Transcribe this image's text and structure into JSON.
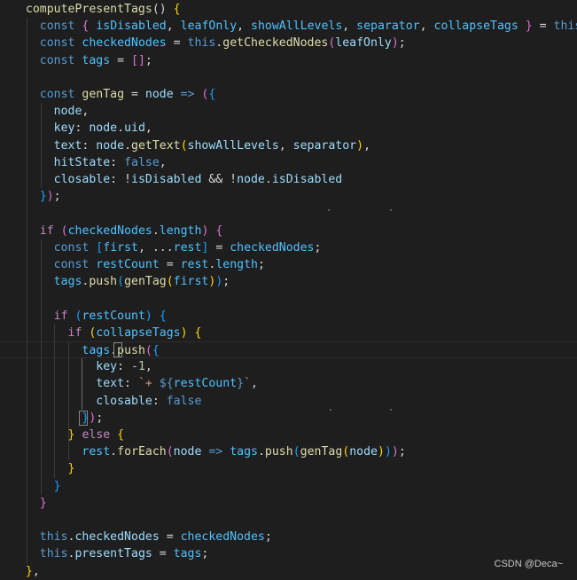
{
  "editor": {
    "background": "#1e1e1e",
    "lines": [
      {
        "tokens": [
          {
            "t": "  ",
            "c": "#d4d4d4"
          },
          {
            "t": "computePresentTags",
            "c": "#dcdcaa"
          },
          {
            "t": "() ",
            "c": "#d4d4d4"
          },
          {
            "t": "{",
            "c": "#ffd700"
          }
        ]
      },
      {
        "tokens": [
          {
            "t": "    ",
            "c": "#d4d4d4"
          },
          {
            "t": "const",
            "c": "#569cd6"
          },
          {
            "t": " ",
            "c": "#d4d4d4"
          },
          {
            "t": "{",
            "c": "#da70d6"
          },
          {
            "t": " ",
            "c": "#d4d4d4"
          },
          {
            "t": "isDisabled",
            "c": "#4fc1ff"
          },
          {
            "t": ", ",
            "c": "#d4d4d4"
          },
          {
            "t": "leafOnly",
            "c": "#4fc1ff"
          },
          {
            "t": ", ",
            "c": "#d4d4d4"
          },
          {
            "t": "showAllLevels",
            "c": "#4fc1ff"
          },
          {
            "t": ", ",
            "c": "#d4d4d4"
          },
          {
            "t": "separator",
            "c": "#4fc1ff"
          },
          {
            "t": ", ",
            "c": "#d4d4d4"
          },
          {
            "t": "collapseTags",
            "c": "#4fc1ff"
          },
          {
            "t": " ",
            "c": "#d4d4d4"
          },
          {
            "t": "}",
            "c": "#da70d6"
          },
          {
            "t": " = ",
            "c": "#d4d4d4"
          },
          {
            "t": "this",
            "c": "#569cd6"
          },
          {
            "t": ";",
            "c": "#d4d4d4"
          }
        ]
      },
      {
        "tokens": [
          {
            "t": "    ",
            "c": "#d4d4d4"
          },
          {
            "t": "const",
            "c": "#569cd6"
          },
          {
            "t": " ",
            "c": "#d4d4d4"
          },
          {
            "t": "checkedNodes",
            "c": "#4fc1ff"
          },
          {
            "t": " = ",
            "c": "#d4d4d4"
          },
          {
            "t": "this",
            "c": "#569cd6"
          },
          {
            "t": ".",
            "c": "#d4d4d4"
          },
          {
            "t": "getCheckedNodes",
            "c": "#dcdcaa"
          },
          {
            "t": "(",
            "c": "#da70d6"
          },
          {
            "t": "leafOnly",
            "c": "#9cdcfe"
          },
          {
            "t": ")",
            "c": "#da70d6"
          },
          {
            "t": ";",
            "c": "#d4d4d4"
          }
        ]
      },
      {
        "tokens": [
          {
            "t": "    ",
            "c": "#d4d4d4"
          },
          {
            "t": "const",
            "c": "#569cd6"
          },
          {
            "t": " ",
            "c": "#d4d4d4"
          },
          {
            "t": "tags",
            "c": "#4fc1ff"
          },
          {
            "t": " = ",
            "c": "#d4d4d4"
          },
          {
            "t": "[]",
            "c": "#da70d6"
          },
          {
            "t": ";",
            "c": "#d4d4d4"
          }
        ]
      },
      {
        "tokens": []
      },
      {
        "tokens": [
          {
            "t": "    ",
            "c": "#d4d4d4"
          },
          {
            "t": "const",
            "c": "#569cd6"
          },
          {
            "t": " ",
            "c": "#d4d4d4"
          },
          {
            "t": "genTag",
            "c": "#dcdcaa"
          },
          {
            "t": " = ",
            "c": "#d4d4d4"
          },
          {
            "t": "node",
            "c": "#9cdcfe"
          },
          {
            "t": " => ",
            "c": "#569cd6"
          },
          {
            "t": "(",
            "c": "#da70d6"
          },
          {
            "t": "{",
            "c": "#179fff"
          }
        ]
      },
      {
        "tokens": [
          {
            "t": "      ",
            "c": "#d4d4d4"
          },
          {
            "t": "node",
            "c": "#9cdcfe"
          },
          {
            "t": ",",
            "c": "#d4d4d4"
          }
        ]
      },
      {
        "tokens": [
          {
            "t": "      ",
            "c": "#d4d4d4"
          },
          {
            "t": "key",
            "c": "#9cdcfe"
          },
          {
            "t": ": ",
            "c": "#d4d4d4"
          },
          {
            "t": "node",
            "c": "#9cdcfe"
          },
          {
            "t": ".",
            "c": "#d4d4d4"
          },
          {
            "t": "uid",
            "c": "#9cdcfe"
          },
          {
            "t": ",",
            "c": "#d4d4d4"
          }
        ]
      },
      {
        "tokens": [
          {
            "t": "      ",
            "c": "#d4d4d4"
          },
          {
            "t": "text",
            "c": "#9cdcfe"
          },
          {
            "t": ": ",
            "c": "#d4d4d4"
          },
          {
            "t": "node",
            "c": "#9cdcfe"
          },
          {
            "t": ".",
            "c": "#d4d4d4"
          },
          {
            "t": "getText",
            "c": "#dcdcaa"
          },
          {
            "t": "(",
            "c": "#ffd700"
          },
          {
            "t": "showAllLevels",
            "c": "#9cdcfe"
          },
          {
            "t": ", ",
            "c": "#d4d4d4"
          },
          {
            "t": "separator",
            "c": "#9cdcfe"
          },
          {
            "t": ")",
            "c": "#ffd700"
          },
          {
            "t": ",",
            "c": "#d4d4d4"
          }
        ]
      },
      {
        "tokens": [
          {
            "t": "      ",
            "c": "#d4d4d4"
          },
          {
            "t": "hitState",
            "c": "#9cdcfe"
          },
          {
            "t": ": ",
            "c": "#d4d4d4"
          },
          {
            "t": "false",
            "c": "#569cd6"
          },
          {
            "t": ",",
            "c": "#d4d4d4"
          }
        ]
      },
      {
        "tokens": [
          {
            "t": "      ",
            "c": "#d4d4d4"
          },
          {
            "t": "closable",
            "c": "#9cdcfe"
          },
          {
            "t": ": !",
            "c": "#d4d4d4"
          },
          {
            "t": "isDisabled",
            "c": "#9cdcfe"
          },
          {
            "t": " && !",
            "c": "#d4d4d4"
          },
          {
            "t": "node",
            "c": "#9cdcfe"
          },
          {
            "t": ".",
            "c": "#d4d4d4"
          },
          {
            "t": "isDisabled",
            "c": "#9cdcfe"
          }
        ]
      },
      {
        "tokens": [
          {
            "t": "    ",
            "c": "#d4d4d4"
          },
          {
            "t": "}",
            "c": "#179fff"
          },
          {
            "t": ")",
            "c": "#da70d6"
          },
          {
            "t": ";",
            "c": "#d4d4d4"
          }
        ]
      },
      {
        "tokens": []
      },
      {
        "tokens": [
          {
            "t": "    ",
            "c": "#d4d4d4"
          },
          {
            "t": "if",
            "c": "#c586c0"
          },
          {
            "t": " ",
            "c": "#d4d4d4"
          },
          {
            "t": "(",
            "c": "#da70d6"
          },
          {
            "t": "checkedNodes",
            "c": "#4fc1ff"
          },
          {
            "t": ".",
            "c": "#d4d4d4"
          },
          {
            "t": "length",
            "c": "#4fc1ff"
          },
          {
            "t": ")",
            "c": "#da70d6"
          },
          {
            "t": " ",
            "c": "#d4d4d4"
          },
          {
            "t": "{",
            "c": "#da70d6"
          }
        ]
      },
      {
        "tokens": [
          {
            "t": "      ",
            "c": "#d4d4d4"
          },
          {
            "t": "const",
            "c": "#569cd6"
          },
          {
            "t": " ",
            "c": "#d4d4d4"
          },
          {
            "t": "[",
            "c": "#179fff"
          },
          {
            "t": "first",
            "c": "#4fc1ff"
          },
          {
            "t": ", ...",
            "c": "#d4d4d4"
          },
          {
            "t": "rest",
            "c": "#4fc1ff"
          },
          {
            "t": "]",
            "c": "#179fff"
          },
          {
            "t": " = ",
            "c": "#d4d4d4"
          },
          {
            "t": "checkedNodes",
            "c": "#4fc1ff"
          },
          {
            "t": ";",
            "c": "#d4d4d4"
          }
        ]
      },
      {
        "tokens": [
          {
            "t": "      ",
            "c": "#d4d4d4"
          },
          {
            "t": "const",
            "c": "#569cd6"
          },
          {
            "t": " ",
            "c": "#d4d4d4"
          },
          {
            "t": "restCount",
            "c": "#4fc1ff"
          },
          {
            "t": " = ",
            "c": "#d4d4d4"
          },
          {
            "t": "rest",
            "c": "#4fc1ff"
          },
          {
            "t": ".",
            "c": "#d4d4d4"
          },
          {
            "t": "length",
            "c": "#4fc1ff"
          },
          {
            "t": ";",
            "c": "#d4d4d4"
          }
        ]
      },
      {
        "tokens": [
          {
            "t": "      ",
            "c": "#d4d4d4"
          },
          {
            "t": "tags",
            "c": "#4fc1ff"
          },
          {
            "t": ".",
            "c": "#d4d4d4"
          },
          {
            "t": "push",
            "c": "#dcdcaa"
          },
          {
            "t": "(",
            "c": "#179fff"
          },
          {
            "t": "genTag",
            "c": "#dcdcaa"
          },
          {
            "t": "(",
            "c": "#ffd700"
          },
          {
            "t": "first",
            "c": "#4fc1ff"
          },
          {
            "t": ")",
            "c": "#ffd700"
          },
          {
            "t": ")",
            "c": "#179fff"
          },
          {
            "t": ";",
            "c": "#d4d4d4"
          }
        ]
      },
      {
        "tokens": []
      },
      {
        "tokens": [
          {
            "t": "      ",
            "c": "#d4d4d4"
          },
          {
            "t": "if",
            "c": "#c586c0"
          },
          {
            "t": " ",
            "c": "#d4d4d4"
          },
          {
            "t": "(",
            "c": "#179fff"
          },
          {
            "t": "restCount",
            "c": "#4fc1ff"
          },
          {
            "t": ")",
            "c": "#179fff"
          },
          {
            "t": " ",
            "c": "#d4d4d4"
          },
          {
            "t": "{",
            "c": "#179fff"
          }
        ]
      },
      {
        "tokens": [
          {
            "t": "        ",
            "c": "#d4d4d4"
          },
          {
            "t": "if",
            "c": "#c586c0"
          },
          {
            "t": " ",
            "c": "#d4d4d4"
          },
          {
            "t": "(",
            "c": "#ffd700"
          },
          {
            "t": "collapseTags",
            "c": "#4fc1ff"
          },
          {
            "t": ")",
            "c": "#ffd700"
          },
          {
            "t": " ",
            "c": "#d4d4d4"
          },
          {
            "t": "{",
            "c": "#ffd700"
          }
        ]
      },
      {
        "tokens": [
          {
            "t": "          ",
            "c": "#d4d4d4"
          },
          {
            "t": "tags",
            "c": "#4fc1ff"
          },
          {
            "t": ".",
            "c": "#d4d4d4"
          },
          {
            "t": "push",
            "c": "#dcdcaa"
          },
          {
            "t": "(",
            "c": "#da70d6"
          },
          {
            "t": "{",
            "c": "#179fff"
          }
        ]
      },
      {
        "tokens": [
          {
            "t": "            ",
            "c": "#d4d4d4"
          },
          {
            "t": "key",
            "c": "#9cdcfe"
          },
          {
            "t": ": ",
            "c": "#d4d4d4"
          },
          {
            "t": "-1",
            "c": "#b5cea8"
          },
          {
            "t": ",",
            "c": "#d4d4d4"
          }
        ]
      },
      {
        "tokens": [
          {
            "t": "            ",
            "c": "#d4d4d4"
          },
          {
            "t": "text",
            "c": "#9cdcfe"
          },
          {
            "t": ": ",
            "c": "#d4d4d4"
          },
          {
            "t": "`+ ",
            "c": "#ce9178"
          },
          {
            "t": "${",
            "c": "#569cd6"
          },
          {
            "t": "restCount",
            "c": "#4fc1ff"
          },
          {
            "t": "}",
            "c": "#569cd6"
          },
          {
            "t": "`",
            "c": "#ce9178"
          },
          {
            "t": ",",
            "c": "#d4d4d4"
          }
        ]
      },
      {
        "tokens": [
          {
            "t": "            ",
            "c": "#d4d4d4"
          },
          {
            "t": "closable",
            "c": "#9cdcfe"
          },
          {
            "t": ": ",
            "c": "#d4d4d4"
          },
          {
            "t": "false",
            "c": "#569cd6"
          }
        ]
      },
      {
        "tokens": [
          {
            "t": "          ",
            "c": "#d4d4d4"
          },
          {
            "t": "}",
            "c": "#179fff"
          },
          {
            "t": ")",
            "c": "#da70d6"
          },
          {
            "t": ";",
            "c": "#d4d4d4"
          }
        ]
      },
      {
        "tokens": [
          {
            "t": "        ",
            "c": "#d4d4d4"
          },
          {
            "t": "}",
            "c": "#ffd700"
          },
          {
            "t": " ",
            "c": "#d4d4d4"
          },
          {
            "t": "else",
            "c": "#c586c0"
          },
          {
            "t": " ",
            "c": "#d4d4d4"
          },
          {
            "t": "{",
            "c": "#ffd700"
          }
        ]
      },
      {
        "tokens": [
          {
            "t": "          ",
            "c": "#d4d4d4"
          },
          {
            "t": "rest",
            "c": "#4fc1ff"
          },
          {
            "t": ".",
            "c": "#d4d4d4"
          },
          {
            "t": "forEach",
            "c": "#dcdcaa"
          },
          {
            "t": "(",
            "c": "#da70d6"
          },
          {
            "t": "node",
            "c": "#9cdcfe"
          },
          {
            "t": " => ",
            "c": "#569cd6"
          },
          {
            "t": "tags",
            "c": "#4fc1ff"
          },
          {
            "t": ".",
            "c": "#d4d4d4"
          },
          {
            "t": "push",
            "c": "#dcdcaa"
          },
          {
            "t": "(",
            "c": "#179fff"
          },
          {
            "t": "genTag",
            "c": "#dcdcaa"
          },
          {
            "t": "(",
            "c": "#ffd700"
          },
          {
            "t": "node",
            "c": "#9cdcfe"
          },
          {
            "t": ")",
            "c": "#ffd700"
          },
          {
            "t": ")",
            "c": "#179fff"
          },
          {
            "t": ")",
            "c": "#da70d6"
          },
          {
            "t": ";",
            "c": "#d4d4d4"
          }
        ]
      },
      {
        "tokens": [
          {
            "t": "        ",
            "c": "#d4d4d4"
          },
          {
            "t": "}",
            "c": "#ffd700"
          }
        ]
      },
      {
        "tokens": [
          {
            "t": "      ",
            "c": "#d4d4d4"
          },
          {
            "t": "}",
            "c": "#179fff"
          }
        ]
      },
      {
        "tokens": [
          {
            "t": "    ",
            "c": "#d4d4d4"
          },
          {
            "t": "}",
            "c": "#da70d6"
          }
        ]
      },
      {
        "tokens": []
      },
      {
        "tokens": [
          {
            "t": "    ",
            "c": "#d4d4d4"
          },
          {
            "t": "this",
            "c": "#569cd6"
          },
          {
            "t": ".",
            "c": "#d4d4d4"
          },
          {
            "t": "checkedNodes",
            "c": "#9cdcfe"
          },
          {
            "t": " = ",
            "c": "#d4d4d4"
          },
          {
            "t": "checkedNodes",
            "c": "#4fc1ff"
          },
          {
            "t": ";",
            "c": "#d4d4d4"
          }
        ]
      },
      {
        "tokens": [
          {
            "t": "    ",
            "c": "#d4d4d4"
          },
          {
            "t": "this",
            "c": "#569cd6"
          },
          {
            "t": ".",
            "c": "#d4d4d4"
          },
          {
            "t": "presentTags",
            "c": "#9cdcfe"
          },
          {
            "t": " = ",
            "c": "#d4d4d4"
          },
          {
            "t": "tags",
            "c": "#4fc1ff"
          },
          {
            "t": ";",
            "c": "#d4d4d4"
          }
        ]
      },
      {
        "tokens": [
          {
            "t": "  ",
            "c": "#d4d4d4"
          },
          {
            "t": "}",
            "c": "#ffd700"
          },
          {
            "t": ",",
            "c": "#d4d4d4"
          }
        ]
      }
    ]
  },
  "watermark": "CSDN @Deca~"
}
